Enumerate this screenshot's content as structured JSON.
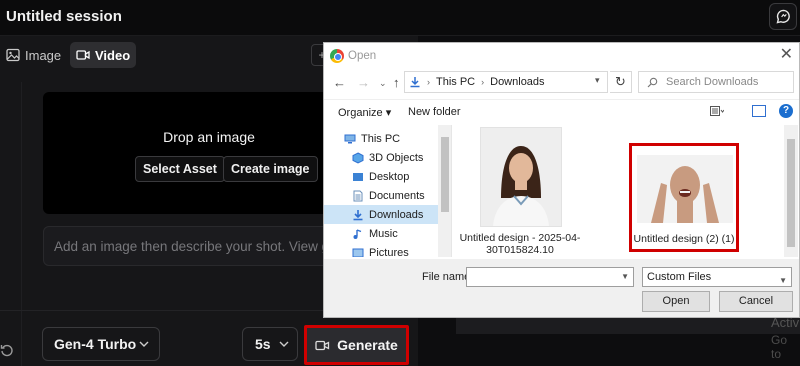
{
  "app": {
    "session_title": "Untitled session",
    "tabs": [
      {
        "label": "Image",
        "icon": "image-icon"
      },
      {
        "label": "Video",
        "icon": "video-icon"
      }
    ],
    "drop_zone": {
      "title": "Drop an image",
      "select_asset": "Select Asset",
      "create_image": "Create image"
    },
    "prompt_placeholder": "Add an image then describe your shot. View guide",
    "model": "Gen-4 Turbo",
    "duration": "5s",
    "generate_label": "Generate",
    "accent_highlight": "#d00000",
    "watermark_line1": "Activ",
    "watermark_line2": "Go to"
  },
  "dialog": {
    "title": "Open",
    "breadcrumbs": [
      "This PC",
      "Downloads"
    ],
    "search_placeholder": "Search Downloads",
    "toolbar": {
      "organize": "Organize ▾",
      "new_folder": "New folder"
    },
    "nav_items": [
      {
        "label": "This PC",
        "icon": "computer-icon"
      },
      {
        "label": "3D Objects",
        "icon": "cube-icon"
      },
      {
        "label": "Desktop",
        "icon": "desktop-icon"
      },
      {
        "label": "Documents",
        "icon": "documents-icon"
      },
      {
        "label": "Downloads",
        "icon": "download-icon",
        "selected": true
      },
      {
        "label": "Music",
        "icon": "music-icon"
      },
      {
        "label": "Pictures",
        "icon": "pictures-icon"
      }
    ],
    "files": [
      {
        "name": "Untitled design - 2025-04-30T015824.10"
      },
      {
        "name": "Untitled design (2) (1)",
        "selected": true
      }
    ],
    "file_name_label": "File name:",
    "file_name_value": "",
    "file_type": "Custom Files",
    "open_label": "Open",
    "cancel_label": "Cancel"
  }
}
